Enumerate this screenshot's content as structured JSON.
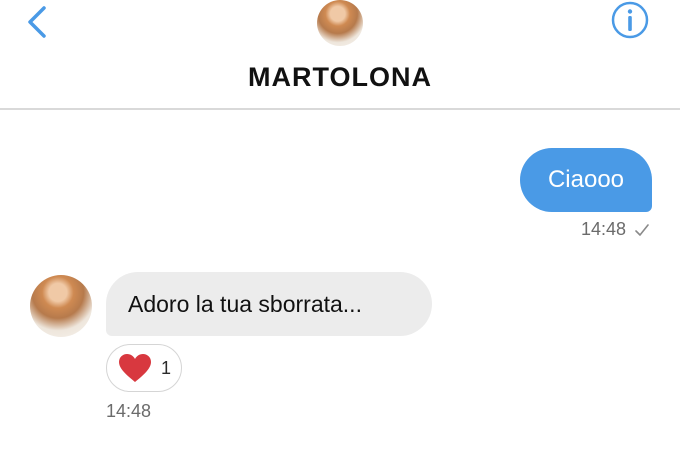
{
  "header": {
    "title": "MARTOLONA",
    "back_icon": "chevron-left-icon",
    "info_icon": "info-circle-icon",
    "accent_color": "#4a9ae6"
  },
  "messages": [
    {
      "direction": "outgoing",
      "text": "Ciaooo",
      "time": "14:48",
      "status_icon": "check-icon"
    },
    {
      "direction": "incoming",
      "text": "Adoro la tua sborrata...",
      "time": "14:48",
      "reaction": {
        "icon": "heart-icon",
        "count": "1",
        "color": "#d8383f"
      }
    }
  ],
  "colors": {
    "outgoing_bubble": "#4a9ae6",
    "incoming_bubble": "#ececec",
    "divider": "#d9d9d9",
    "meta_text": "#6b6b6b"
  }
}
